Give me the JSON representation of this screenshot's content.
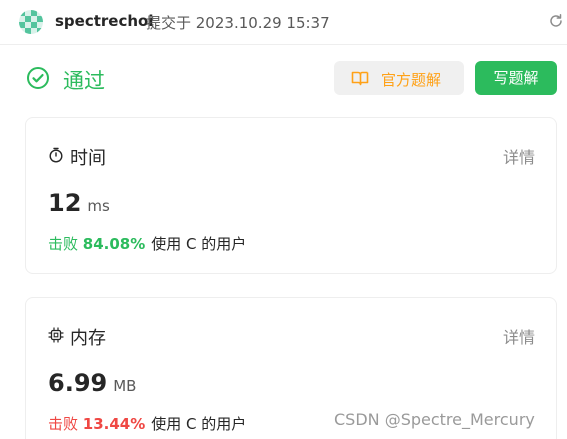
{
  "header": {
    "username": "spectrechoi",
    "submitted_text": "提交于 2023.10.29 15:37"
  },
  "status": {
    "label": "通过",
    "color": "#2cbb5d"
  },
  "actions": {
    "official_solution_label": "官方题解",
    "write_solution_label": "写题解"
  },
  "runtime": {
    "title": "时间",
    "detail_label": "详情",
    "value": "12",
    "unit": "ms",
    "beat_prefix": "击败",
    "beat_percent": "84.08%",
    "beat_suffix": "使用 C 的用户",
    "beat_color": "#2cbb5d"
  },
  "memory": {
    "title": "内存",
    "detail_label": "详情",
    "value": "6.99",
    "unit": "MB",
    "beat_prefix": "击败",
    "beat_percent": "13.44%",
    "beat_suffix": "使用 C 的用户",
    "beat_color": "#ef4743"
  },
  "watermark": "CSDN @Spectre_Mercury"
}
